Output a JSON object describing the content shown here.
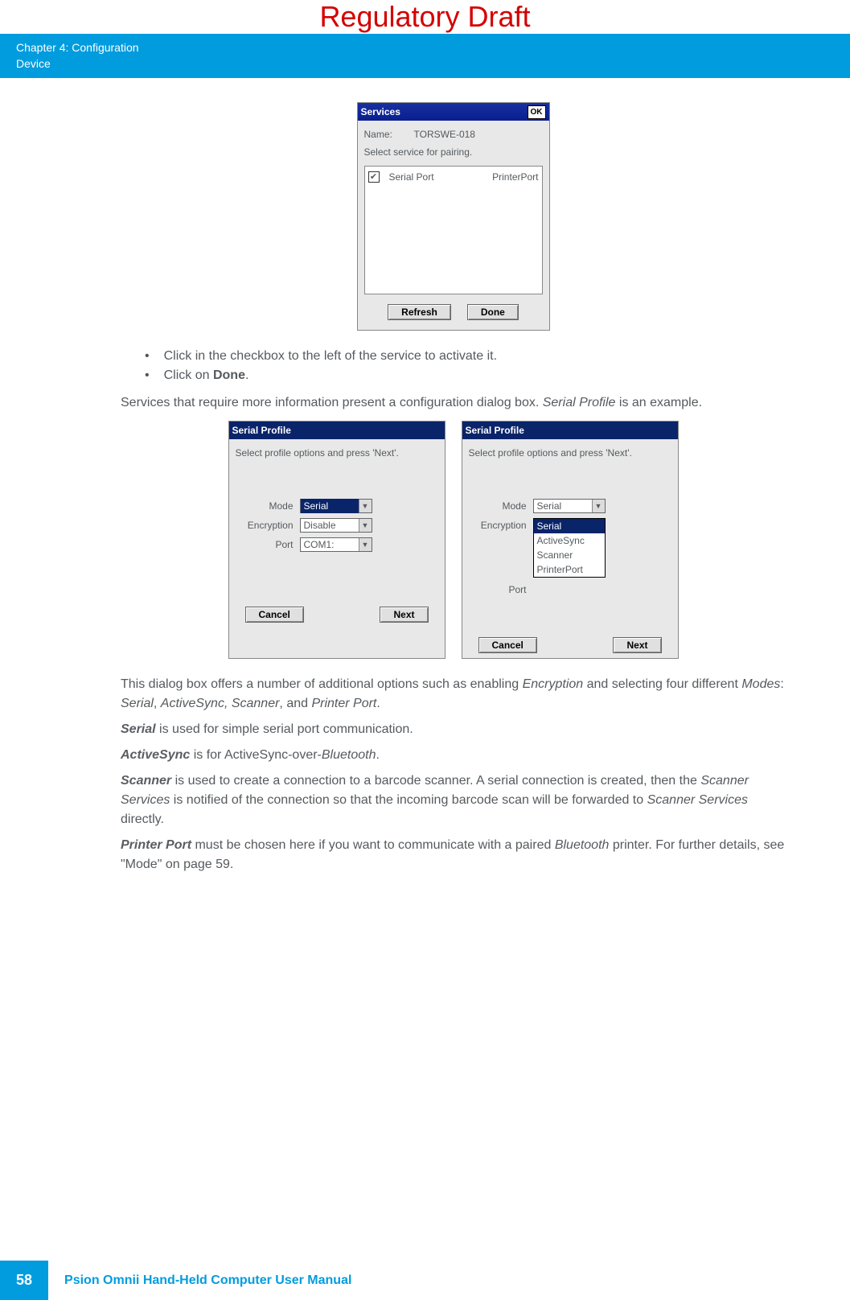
{
  "banner": "Regulatory Draft",
  "header": {
    "l1": "Chapter 4:  Configuration",
    "l2": "Device"
  },
  "services_dialog": {
    "title": "Services",
    "ok": "OK",
    "name_lbl": "Name:",
    "name_val": "TORSWE-018",
    "instr": "Select service for pairing.",
    "row_service": "Serial Port",
    "row_profile": "PrinterPort",
    "btn_refresh": "Refresh",
    "btn_done": "Done"
  },
  "bullets": {
    "b1": "Click in the checkbox to the left of the service to activate it.",
    "b2_pre": "Click on ",
    "b2_bold": "Done",
    "b2_post": "."
  },
  "para1": {
    "pre": "Services that require more information present a configuration dialog box. ",
    "ital": "Serial Profile",
    "post": " is an example."
  },
  "sp_left": {
    "title": "Serial Profile",
    "instr": "Select profile options and press 'Next'.",
    "mode_lbl": "Mode",
    "mode_val": "Serial",
    "enc_lbl": "Encryption",
    "enc_val": "Disable",
    "port_lbl": "Port",
    "port_val": "COM1:",
    "cancel": "Cancel",
    "next": "Next"
  },
  "sp_right": {
    "title": "Serial Profile",
    "instr": "Select profile options and press 'Next'.",
    "mode_lbl": "Mode",
    "mode_val": "Serial",
    "enc_lbl": "Encryption",
    "port_lbl": "Port",
    "dd": {
      "o1": "Serial",
      "o2": "ActiveSync",
      "o3": "Scanner",
      "o4": "PrinterPort"
    },
    "cancel": "Cancel",
    "next": "Next"
  },
  "para2": {
    "t1": "This dialog box offers a number of additional options such as enabling ",
    "i1": "Encryption",
    "t2": " and selecting four different ",
    "i2": "Modes",
    "t3": ": ",
    "i3": "Serial",
    "t4": ", ",
    "i4": "ActiveSync, Scanner",
    "t5": ", and ",
    "i5": "Printer Port",
    "t6": "."
  },
  "p_serial": {
    "b": "Serial",
    "t": " is used for simple serial port communication."
  },
  "p_active": {
    "b": "ActiveSync",
    "t1": " is for ActiveSync-over-",
    "i": "Bluetooth",
    "t2": "."
  },
  "p_scanner": {
    "b": "Scanner",
    "t1": " is used to create a connection to a barcode scanner. A serial connection is created, then the ",
    "i1": "Scanner Services",
    "t2": " is notified of the connection so that the incoming barcode scan will be forwarded to ",
    "i2": "Scanner Services",
    "t3": " directly."
  },
  "p_printer": {
    "b": "Printer Port",
    "t1": " must be chosen here if you want to communicate with a paired ",
    "i": "Bluetooth",
    "t2": " printer. For further details, see \"Mode\" on page 59."
  },
  "footer": {
    "page": "58",
    "manual": "Psion Omnii Hand-Held Computer User Manual"
  }
}
